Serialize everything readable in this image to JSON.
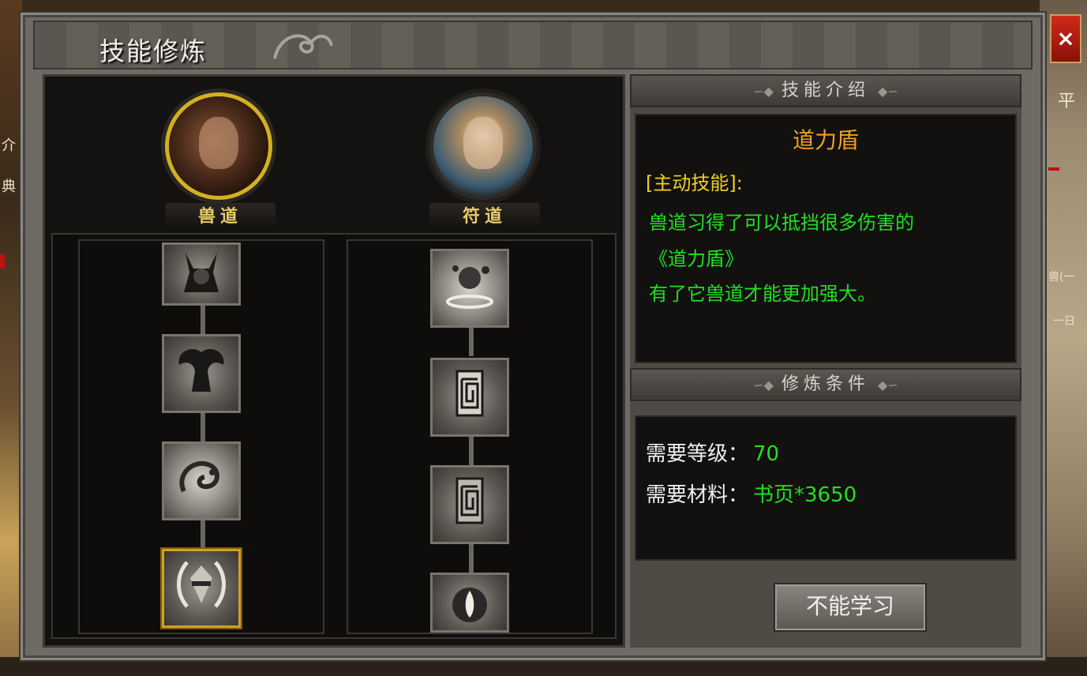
{
  "window": {
    "title": "技能修炼",
    "close_label": "×"
  },
  "schools": [
    {
      "name": "兽道",
      "selected": true
    },
    {
      "name": "符道",
      "selected": false
    }
  ],
  "skill_trees": {
    "beast": [
      {
        "icon": "horned-demon-icon"
      },
      {
        "icon": "winged-beast-icon"
      },
      {
        "icon": "coiled-creature-icon"
      },
      {
        "icon": "tao-shield-icon",
        "selected": true
      }
    ],
    "talisman": [
      {
        "icon": "spell-burst-icon"
      },
      {
        "icon": "talisman-scroll-icon"
      },
      {
        "icon": "talisman-scroll-icon"
      },
      {
        "icon": "flame-orb-icon"
      }
    ]
  },
  "skill_info": {
    "header": "技能介绍",
    "name": "道力盾",
    "type": "[主动技能]:",
    "description": [
      "兽道习得了可以抵挡很多伤害的",
      "《道力盾》",
      "有了它兽道才能更加强大。"
    ]
  },
  "requirements": {
    "header": "修炼条件",
    "level_label": "需要等级：",
    "level_value": "70",
    "material_label": "需要材料：",
    "material_value": "书页*3650"
  },
  "learn_button": "不能学习",
  "background": {
    "side_glyphs": [
      "平",
      "介",
      "典"
    ],
    "side_texts": [
      "兽(一",
      "一日"
    ]
  },
  "colors": {
    "skill_name": "#f0a020",
    "skill_type": "#f0d020",
    "description": "#20e020",
    "selected_border": "#d4a020"
  }
}
